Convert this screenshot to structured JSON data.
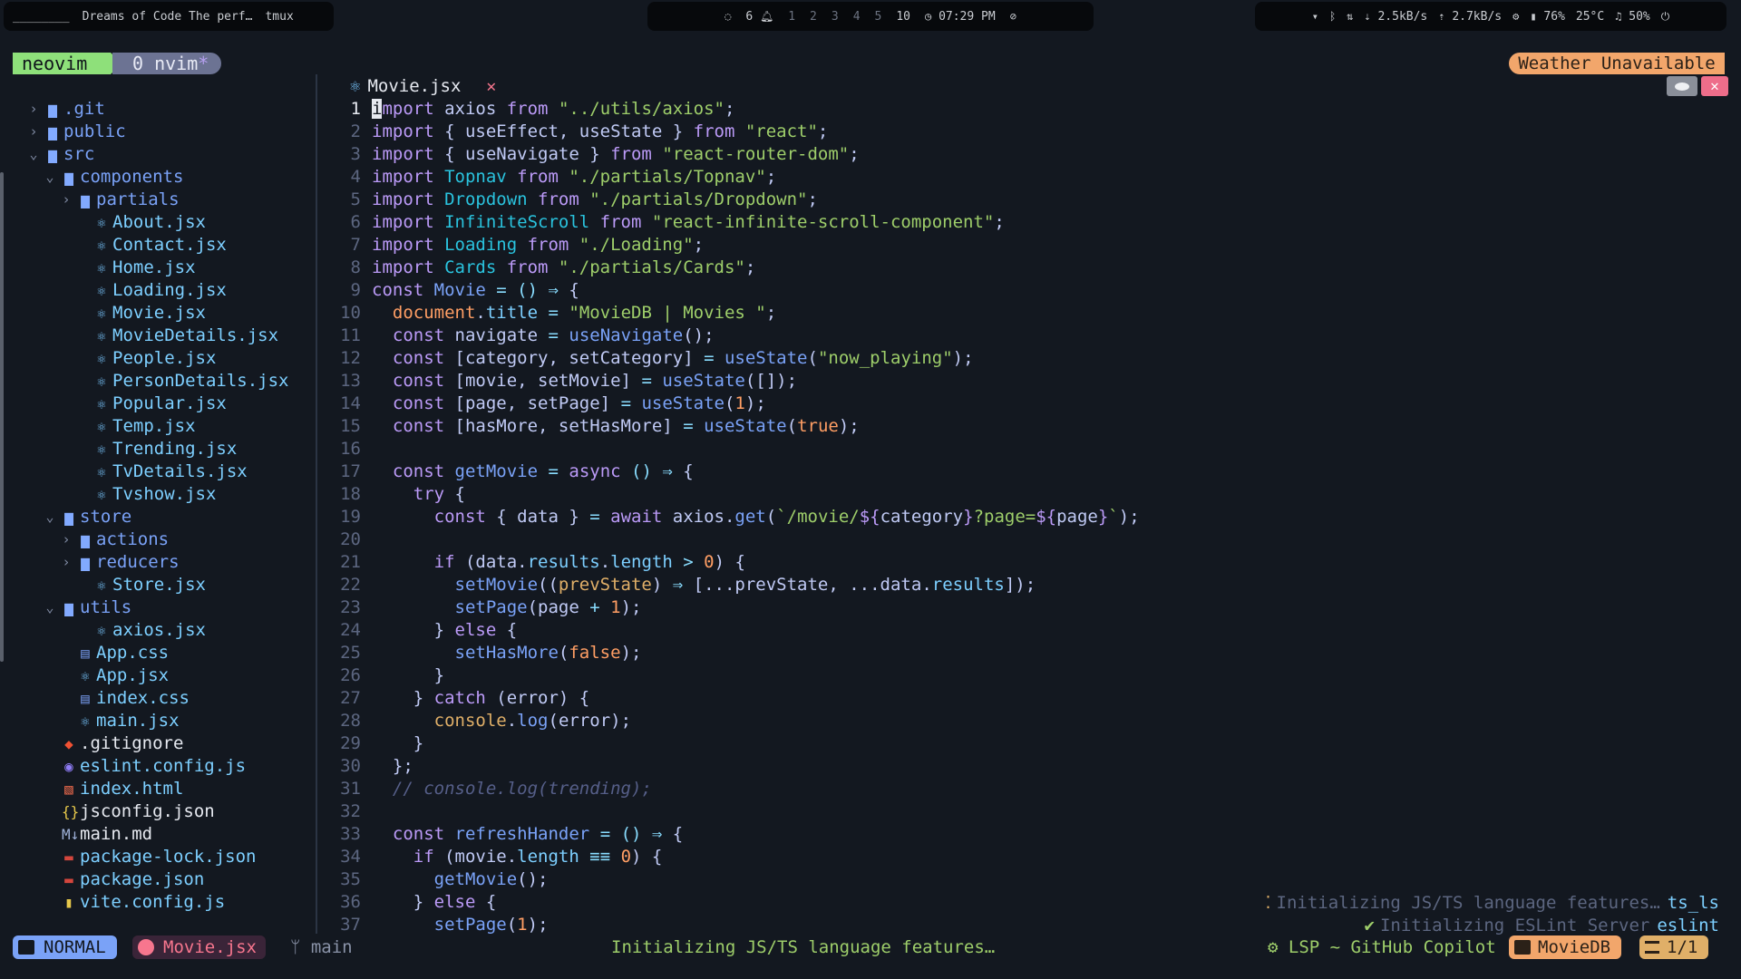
{
  "topbar": {
    "left": {
      "workspace": "________",
      "window_title": "Dreams of Code  The perf…",
      "app": "tmux"
    },
    "center": {
      "items": [
        "6",
        "1",
        "2",
        "3",
        "4",
        "5",
        "10"
      ],
      "clock": "07:29 PM"
    },
    "right": {
      "net_down": "2.5kB/s",
      "net_up": "2.7kB/s",
      "battery": "76%",
      "temp": "25°C",
      "volume": "50%"
    }
  },
  "tmux": {
    "tab1": "neovim",
    "tab2_prefix": "0 nvim",
    "tab2_star": "*"
  },
  "weather": "Weather Unavailable",
  "buffer_tab": {
    "name": "Movie.jsx",
    "close": "✕"
  },
  "tree": [
    {
      "label": ".git",
      "depth": 0,
      "chev": "›",
      "icon": "▆",
      "kind": "dir"
    },
    {
      "label": "public",
      "depth": 0,
      "chev": "›",
      "icon": "▆",
      "kind": "dir"
    },
    {
      "label": "src",
      "depth": 0,
      "chev": "⌄",
      "icon": "▆",
      "kind": "dir"
    },
    {
      "label": "components",
      "depth": 1,
      "chev": "⌄",
      "icon": "▆",
      "kind": "dir"
    },
    {
      "label": "partials",
      "depth": 2,
      "chev": "›",
      "icon": "▆",
      "kind": "dir"
    },
    {
      "label": "About.jsx",
      "depth": 3,
      "chev": "",
      "icon": "⚛",
      "kind": "react"
    },
    {
      "label": "Contact.jsx",
      "depth": 3,
      "chev": "",
      "icon": "⚛",
      "kind": "react"
    },
    {
      "label": "Home.jsx",
      "depth": 3,
      "chev": "",
      "icon": "⚛",
      "kind": "react"
    },
    {
      "label": "Loading.jsx",
      "depth": 3,
      "chev": "",
      "icon": "⚛",
      "kind": "react"
    },
    {
      "label": "Movie.jsx",
      "depth": 3,
      "chev": "",
      "icon": "⚛",
      "kind": "react"
    },
    {
      "label": "MovieDetails.jsx",
      "depth": 3,
      "chev": "",
      "icon": "⚛",
      "kind": "react"
    },
    {
      "label": "People.jsx",
      "depth": 3,
      "chev": "",
      "icon": "⚛",
      "kind": "react"
    },
    {
      "label": "PersonDetails.jsx",
      "depth": 3,
      "chev": "",
      "icon": "⚛",
      "kind": "react"
    },
    {
      "label": "Popular.jsx",
      "depth": 3,
      "chev": "",
      "icon": "⚛",
      "kind": "react"
    },
    {
      "label": "Temp.jsx",
      "depth": 3,
      "chev": "",
      "icon": "⚛",
      "kind": "react"
    },
    {
      "label": "Trending.jsx",
      "depth": 3,
      "chev": "",
      "icon": "⚛",
      "kind": "react"
    },
    {
      "label": "TvDetails.jsx",
      "depth": 3,
      "chev": "",
      "icon": "⚛",
      "kind": "react"
    },
    {
      "label": "Tvshow.jsx",
      "depth": 3,
      "chev": "",
      "icon": "⚛",
      "kind": "react"
    },
    {
      "label": "store",
      "depth": 1,
      "chev": "⌄",
      "icon": "▆",
      "kind": "dir"
    },
    {
      "label": "actions",
      "depth": 2,
      "chev": "›",
      "icon": "▆",
      "kind": "dir"
    },
    {
      "label": "reducers",
      "depth": 2,
      "chev": "›",
      "icon": "▆",
      "kind": "dir"
    },
    {
      "label": "Store.jsx",
      "depth": 3,
      "chev": "",
      "icon": "⚛",
      "kind": "react"
    },
    {
      "label": "utils",
      "depth": 1,
      "chev": "⌄",
      "icon": "▆",
      "kind": "dir"
    },
    {
      "label": "axios.jsx",
      "depth": 3,
      "chev": "",
      "icon": "⚛",
      "kind": "react"
    },
    {
      "label": "App.css",
      "depth": 2,
      "chev": "",
      "icon": "▤",
      "kind": "css"
    },
    {
      "label": "App.jsx",
      "depth": 2,
      "chev": "",
      "icon": "⚛",
      "kind": "react"
    },
    {
      "label": "index.css",
      "depth": 2,
      "chev": "",
      "icon": "▤",
      "kind": "css"
    },
    {
      "label": "main.jsx",
      "depth": 2,
      "chev": "",
      "icon": "⚛",
      "kind": "react"
    },
    {
      "label": ".gitignore",
      "depth": 1,
      "chev": "",
      "icon": "◆",
      "kind": "git"
    },
    {
      "label": "eslint.config.js",
      "depth": 1,
      "chev": "",
      "icon": "◉",
      "kind": "eslint"
    },
    {
      "label": "index.html",
      "depth": 1,
      "chev": "",
      "icon": "▧",
      "kind": "html"
    },
    {
      "label": "jsconfig.json",
      "depth": 1,
      "chev": "",
      "icon": "{}",
      "kind": "json"
    },
    {
      "label": "main.md",
      "depth": 1,
      "chev": "",
      "icon": "M↓",
      "kind": "md"
    },
    {
      "label": "package-lock.json",
      "depth": 1,
      "chev": "",
      "icon": "▬",
      "kind": "npm"
    },
    {
      "label": "package.json",
      "depth": 1,
      "chev": "",
      "icon": "▬",
      "kind": "npm"
    },
    {
      "label": "vite.config.js",
      "depth": 1,
      "chev": "",
      "icon": "▮",
      "kind": "vite"
    }
  ],
  "code": [
    {
      "n": "1",
      "cur": true,
      "seg": [
        [
          "cursor",
          "i"
        ],
        [
          "k",
          "mport"
        ],
        [
          "v",
          " axios "
        ],
        [
          "k",
          "from"
        ],
        [
          "s",
          " \"../utils/axios\""
        ],
        [
          "v",
          ";"
        ]
      ]
    },
    {
      "n": "2",
      "seg": [
        [
          "k",
          "import"
        ],
        [
          "v",
          " { useEffect, useState } "
        ],
        [
          "k",
          "from"
        ],
        [
          "s",
          " \"react\""
        ],
        [
          "v",
          ";"
        ]
      ]
    },
    {
      "n": "3",
      "seg": [
        [
          "k",
          "import"
        ],
        [
          "v",
          " { useNavigate } "
        ],
        [
          "k",
          "from"
        ],
        [
          "s",
          " \"react-router-dom\""
        ],
        [
          "v",
          ";"
        ]
      ]
    },
    {
      "n": "4",
      "seg": [
        [
          "k",
          "import"
        ],
        [
          "t",
          " Topnav "
        ],
        [
          "k",
          "from"
        ],
        [
          "s",
          " \"./partials/Topnav\""
        ],
        [
          "v",
          ";"
        ]
      ]
    },
    {
      "n": "5",
      "seg": [
        [
          "k",
          "import"
        ],
        [
          "t",
          " Dropdown "
        ],
        [
          "k",
          "from"
        ],
        [
          "s",
          " \"./partials/Dropdown\""
        ],
        [
          "v",
          ";"
        ]
      ]
    },
    {
      "n": "6",
      "seg": [
        [
          "k",
          "import"
        ],
        [
          "t",
          " InfiniteScroll "
        ],
        [
          "k",
          "from"
        ],
        [
          "s",
          " \"react-infinite-scroll-component\""
        ],
        [
          "v",
          ";"
        ]
      ]
    },
    {
      "n": "7",
      "seg": [
        [
          "k",
          "import"
        ],
        [
          "t",
          " Loading "
        ],
        [
          "k",
          "from"
        ],
        [
          "s",
          " \"./Loading\""
        ],
        [
          "v",
          ";"
        ]
      ]
    },
    {
      "n": "8",
      "seg": [
        [
          "k",
          "import"
        ],
        [
          "t",
          " Cards "
        ],
        [
          "k",
          "from"
        ],
        [
          "s",
          " \"./partials/Cards\""
        ],
        [
          "v",
          ";"
        ]
      ]
    },
    {
      "n": "9",
      "seg": [
        [
          "k",
          "const"
        ],
        [
          "f",
          " Movie"
        ],
        [
          "o",
          " = () ⇒ "
        ],
        [
          "v",
          "{"
        ]
      ]
    },
    {
      "n": "10",
      "seg": [
        [
          "v",
          "  "
        ],
        [
          "n",
          "document"
        ],
        [
          "v",
          "."
        ],
        [
          "b",
          "title"
        ],
        [
          "o",
          " = "
        ],
        [
          "s",
          "\"MovieDB | Movies \""
        ],
        [
          "v",
          ";"
        ]
      ]
    },
    {
      "n": "11",
      "seg": [
        [
          "v",
          "  "
        ],
        [
          "k",
          "const"
        ],
        [
          "v",
          " navigate "
        ],
        [
          "o",
          "= "
        ],
        [
          "f",
          "useNavigate"
        ],
        [
          "v",
          "();"
        ]
      ]
    },
    {
      "n": "12",
      "seg": [
        [
          "v",
          "  "
        ],
        [
          "k",
          "const"
        ],
        [
          "v",
          " [category, setCategory] "
        ],
        [
          "o",
          "= "
        ],
        [
          "f",
          "useState"
        ],
        [
          "v",
          "("
        ],
        [
          "s",
          "\"now_playing\""
        ],
        [
          "v",
          ");"
        ]
      ]
    },
    {
      "n": "13",
      "seg": [
        [
          "v",
          "  "
        ],
        [
          "k",
          "const"
        ],
        [
          "v",
          " [movie, setMovie] "
        ],
        [
          "o",
          "= "
        ],
        [
          "f",
          "useState"
        ],
        [
          "v",
          "([]);"
        ]
      ]
    },
    {
      "n": "14",
      "seg": [
        [
          "v",
          "  "
        ],
        [
          "k",
          "const"
        ],
        [
          "v",
          " [page, setPage] "
        ],
        [
          "o",
          "= "
        ],
        [
          "f",
          "useState"
        ],
        [
          "v",
          "("
        ],
        [
          "n",
          "1"
        ],
        [
          "v",
          ");"
        ]
      ]
    },
    {
      "n": "15",
      "seg": [
        [
          "v",
          "  "
        ],
        [
          "k",
          "const"
        ],
        [
          "v",
          " [hasMore, setHasMore] "
        ],
        [
          "o",
          "= "
        ],
        [
          "f",
          "useState"
        ],
        [
          "v",
          "("
        ],
        [
          "n",
          "true"
        ],
        [
          "v",
          ");"
        ]
      ]
    },
    {
      "n": "16",
      "seg": []
    },
    {
      "n": "17",
      "seg": [
        [
          "v",
          "  "
        ],
        [
          "k",
          "const"
        ],
        [
          "f",
          " getMovie"
        ],
        [
          "o",
          " = "
        ],
        [
          "k",
          "async"
        ],
        [
          "o",
          " () ⇒ "
        ],
        [
          "v",
          "{"
        ]
      ]
    },
    {
      "n": "18",
      "seg": [
        [
          "v",
          "    "
        ],
        [
          "k",
          "try"
        ],
        [
          "v",
          " {"
        ]
      ]
    },
    {
      "n": "19",
      "seg": [
        [
          "v",
          "      "
        ],
        [
          "k",
          "const"
        ],
        [
          "v",
          " { data } "
        ],
        [
          "o",
          "= "
        ],
        [
          "k",
          "await"
        ],
        [
          "v",
          " axios."
        ],
        [
          "f",
          "get"
        ],
        [
          "v",
          "("
        ],
        [
          "s",
          "`/movie/"
        ],
        [
          "k",
          "${"
        ],
        [
          "v",
          "category"
        ],
        [
          "k",
          "}"
        ],
        [
          "s",
          "?page="
        ],
        [
          "k",
          "${"
        ],
        [
          "v",
          "page"
        ],
        [
          "k",
          "}"
        ],
        [
          "s",
          "`"
        ],
        [
          "v",
          ");"
        ]
      ]
    },
    {
      "n": "20",
      "seg": []
    },
    {
      "n": "21",
      "seg": [
        [
          "v",
          "      "
        ],
        [
          "k",
          "if"
        ],
        [
          "v",
          " (data."
        ],
        [
          "b",
          "results"
        ],
        [
          "v",
          "."
        ],
        [
          "b",
          "length"
        ],
        [
          "o",
          " > "
        ],
        [
          "n",
          "0"
        ],
        [
          "v",
          ") {"
        ]
      ]
    },
    {
      "n": "22",
      "seg": [
        [
          "v",
          "        "
        ],
        [
          "f",
          "setMovie"
        ],
        [
          "v",
          "(("
        ],
        [
          "p",
          "prevState"
        ],
        [
          "v",
          ") "
        ],
        [
          "o",
          "⇒"
        ],
        [
          "v",
          " [...prevState, ...data."
        ],
        [
          "b",
          "results"
        ],
        [
          "v",
          "]);"
        ]
      ]
    },
    {
      "n": "23",
      "seg": [
        [
          "v",
          "        "
        ],
        [
          "f",
          "setPage"
        ],
        [
          "v",
          "(page "
        ],
        [
          "o",
          "+ "
        ],
        [
          "n",
          "1"
        ],
        [
          "v",
          ");"
        ]
      ]
    },
    {
      "n": "24",
      "seg": [
        [
          "v",
          "      } "
        ],
        [
          "k",
          "else"
        ],
        [
          "v",
          " {"
        ]
      ]
    },
    {
      "n": "25",
      "seg": [
        [
          "v",
          "        "
        ],
        [
          "f",
          "setHasMore"
        ],
        [
          "v",
          "("
        ],
        [
          "n",
          "false"
        ],
        [
          "v",
          ");"
        ]
      ]
    },
    {
      "n": "26",
      "seg": [
        [
          "v",
          "      }"
        ]
      ]
    },
    {
      "n": "27",
      "seg": [
        [
          "v",
          "    } "
        ],
        [
          "k",
          "catch"
        ],
        [
          "v",
          " (error) {"
        ]
      ]
    },
    {
      "n": "28",
      "seg": [
        [
          "v",
          "      "
        ],
        [
          "p",
          "console"
        ],
        [
          "v",
          "."
        ],
        [
          "f",
          "log"
        ],
        [
          "v",
          "(error);"
        ]
      ]
    },
    {
      "n": "29",
      "seg": [
        [
          "v",
          "    }"
        ]
      ]
    },
    {
      "n": "30",
      "seg": [
        [
          "v",
          "  };"
        ]
      ]
    },
    {
      "n": "31",
      "seg": [
        [
          "c",
          "  // console.log(trending);"
        ]
      ]
    },
    {
      "n": "32",
      "seg": []
    },
    {
      "n": "33",
      "seg": [
        [
          "v",
          "  "
        ],
        [
          "k",
          "const"
        ],
        [
          "f",
          " refreshHander"
        ],
        [
          "o",
          " = () ⇒ "
        ],
        [
          "v",
          "{"
        ]
      ]
    },
    {
      "n": "34",
      "seg": [
        [
          "v",
          "    "
        ],
        [
          "k",
          "if"
        ],
        [
          "v",
          " (movie."
        ],
        [
          "b",
          "length"
        ],
        [
          "o",
          " ≡≡ "
        ],
        [
          "n",
          "0"
        ],
        [
          "v",
          ") {"
        ]
      ]
    },
    {
      "n": "35",
      "seg": [
        [
          "v",
          "      "
        ],
        [
          "f",
          "getMovie"
        ],
        [
          "v",
          "();"
        ]
      ]
    },
    {
      "n": "36",
      "seg": [
        [
          "v",
          "    } "
        ],
        [
          "k",
          "else"
        ],
        [
          "v",
          " {"
        ]
      ]
    },
    {
      "n": "37",
      "seg": [
        [
          "v",
          "      "
        ],
        [
          "f",
          "setPage"
        ],
        [
          "v",
          "("
        ],
        [
          "n",
          "1"
        ],
        [
          "v",
          ");"
        ]
      ]
    }
  ],
  "notifications": [
    {
      "mark": "⁚",
      "msg": "Initializing JS/TS language features…",
      "src": "ts_ls"
    },
    {
      "mark": "✔",
      "msg": "Initializing ESLint Server",
      "src": "eslint"
    }
  ],
  "statusline": {
    "mode": "NORMAL",
    "file": "Movie.jsx",
    "branch_icon": "ᛘ",
    "branch": "main",
    "message": "Initializing JS/TS language features…",
    "lsp": "LSP ~ GitHub Copilot",
    "project": "MovieDB",
    "position": "1/1"
  }
}
